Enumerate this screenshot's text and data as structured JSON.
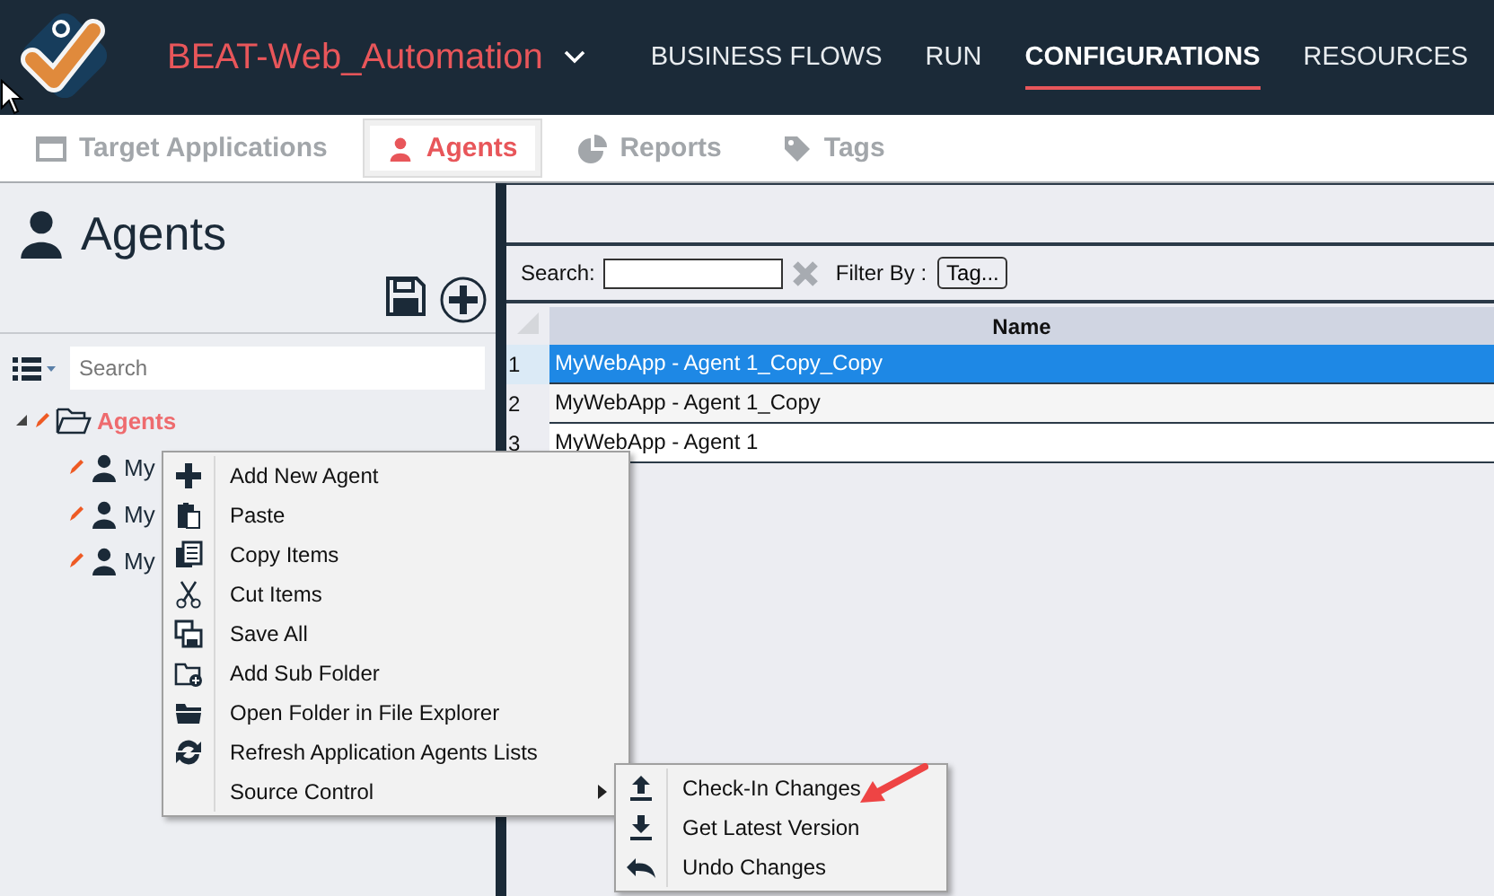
{
  "nav": {
    "project": "BEAT-Web_Automation",
    "items": [
      {
        "label": "BUSINESS FLOWS",
        "selected": false
      },
      {
        "label": "RUN",
        "selected": false
      },
      {
        "label": "CONFIGURATIONS",
        "selected": true
      },
      {
        "label": "RESOURCES",
        "selected": false
      }
    ]
  },
  "tabs": [
    {
      "label": "Target Applications",
      "selected": false
    },
    {
      "label": "Agents",
      "selected": true
    },
    {
      "label": "Reports",
      "selected": false
    },
    {
      "label": "Tags",
      "selected": false
    }
  ],
  "panel": {
    "title": "Agents",
    "search": {
      "placeholder": "Search"
    },
    "tree": [
      {
        "label": "Agents",
        "selected": true,
        "expanded": true,
        "children": [
          {
            "label": "My",
            "selected": false
          },
          {
            "label": "My",
            "selected": false
          },
          {
            "label": "My",
            "selected": false
          }
        ]
      }
    ]
  },
  "grid": {
    "search_label": "Search:",
    "filter_label": "Filter By :",
    "filter_button": "Tag...",
    "columns": [
      "Name"
    ],
    "rows": [
      {
        "number": "1",
        "name": "MyWebApp - Agent 1_Copy_Copy",
        "selected": true
      },
      {
        "number": "2",
        "name": "MyWebApp - Agent 1_Copy",
        "selected": false
      },
      {
        "number": "3",
        "name": "MyWebApp - Agent 1",
        "selected": false
      }
    ]
  },
  "context_menu": {
    "items": [
      {
        "label": "Add New Agent",
        "has_submenu": false
      },
      {
        "label": "Paste",
        "has_submenu": false
      },
      {
        "label": "Copy Items",
        "has_submenu": false
      },
      {
        "label": "Cut Items",
        "has_submenu": false
      },
      {
        "label": "Save All",
        "has_submenu": false
      },
      {
        "label": "Add Sub Folder",
        "has_submenu": false
      },
      {
        "label": "Open Folder in File Explorer",
        "has_submenu": false
      },
      {
        "label": "Refresh Application Agents Lists",
        "has_submenu": false
      },
      {
        "label": "Source Control",
        "has_submenu": true
      }
    ],
    "submenu": [
      {
        "label": "Check-In Changes"
      },
      {
        "label": "Get Latest Version"
      },
      {
        "label": "Undo Changes"
      }
    ]
  }
}
